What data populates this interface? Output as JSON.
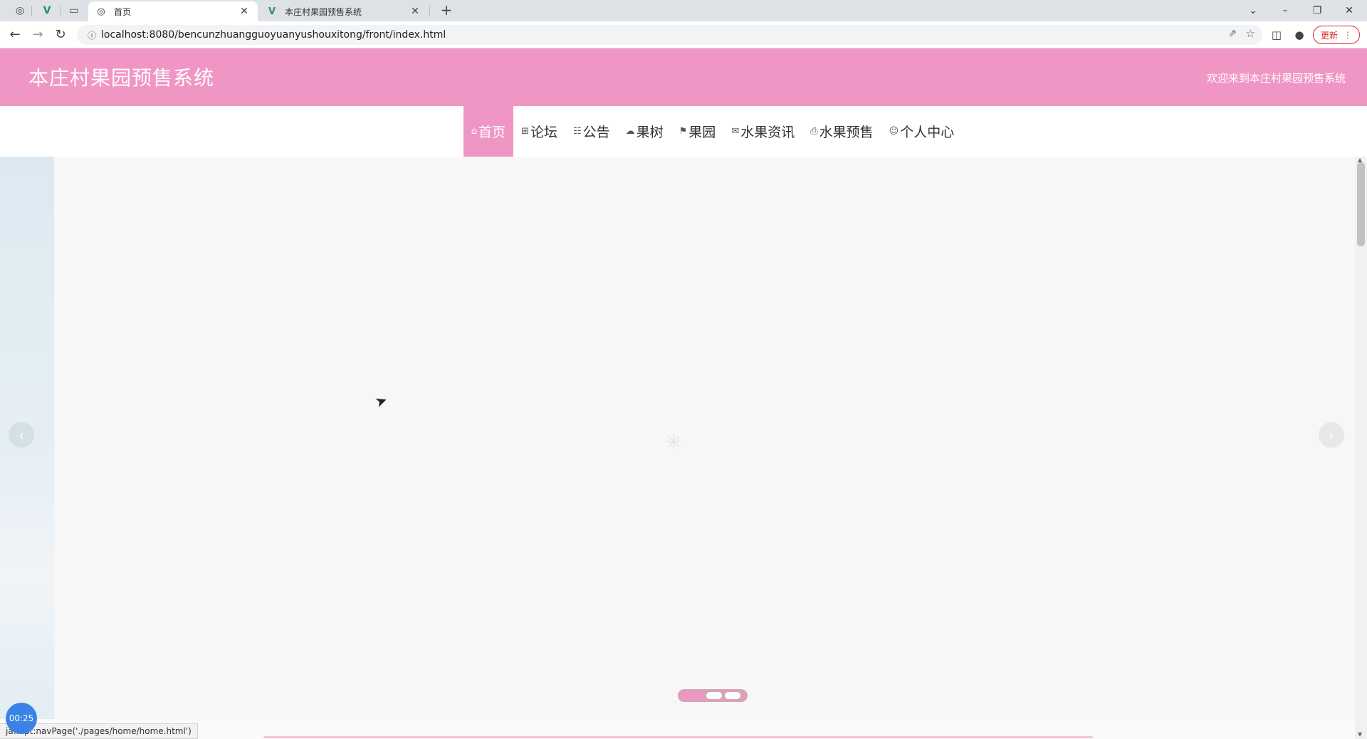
{
  "browser": {
    "pinned_tabs": [
      {
        "icon": "globe-icon",
        "glyph": "◎"
      },
      {
        "icon": "vue-logo-icon",
        "glyph": "V"
      },
      {
        "icon": "blank-page-icon",
        "glyph": "▭"
      }
    ],
    "tabs": [
      {
        "title": "首页",
        "icon": "globe-icon",
        "glyph": "◎",
        "active": true
      },
      {
        "title": "本庄村果园预售系统",
        "icon": "vue-logo-icon",
        "glyph": "V",
        "active": false
      }
    ],
    "close_glyph": "✕",
    "new_tab_glyph": "+",
    "address": {
      "url": "localhost:8080/bencunzhuangguoyuanyushouxitong/front/index.html"
    },
    "update_label": "更新",
    "window_controls": {
      "search": "⌄",
      "minimize": "–",
      "maximize": "❐",
      "close": "✕"
    }
  },
  "site": {
    "title": "本庄村果园预售系统",
    "welcome": "欢迎来到本庄村果园预售系统",
    "accent_color": "#f096c4"
  },
  "menu": {
    "items": [
      {
        "label": "首页",
        "icon": "home-icon",
        "glyph": "⌂",
        "active": true
      },
      {
        "label": "论坛",
        "icon": "forum-icon",
        "glyph": "⊞",
        "active": false
      },
      {
        "label": "公告",
        "icon": "notice-icon",
        "glyph": "☷",
        "active": false
      },
      {
        "label": "果树",
        "icon": "tree-icon",
        "glyph": "☁",
        "active": false
      },
      {
        "label": "果园",
        "icon": "flag-icon",
        "glyph": "⚑",
        "active": false
      },
      {
        "label": "水果资讯",
        "icon": "mail-icon",
        "glyph": "✉",
        "active": false
      },
      {
        "label": "水果预售",
        "icon": "printer-icon",
        "glyph": "⎙",
        "active": false
      },
      {
        "label": "个人中心",
        "icon": "user-icon",
        "glyph": "☺",
        "active": false
      }
    ]
  },
  "carousel": {
    "slide_count": 3,
    "active_index": 0,
    "prev_glyph": "‹",
    "next_glyph": "›",
    "loading_glyph": "✳"
  },
  "status_bar": {
    "text": "ja…ipt:navPage('./pages/home/home.html')"
  },
  "timer": {
    "text": "00:25"
  }
}
